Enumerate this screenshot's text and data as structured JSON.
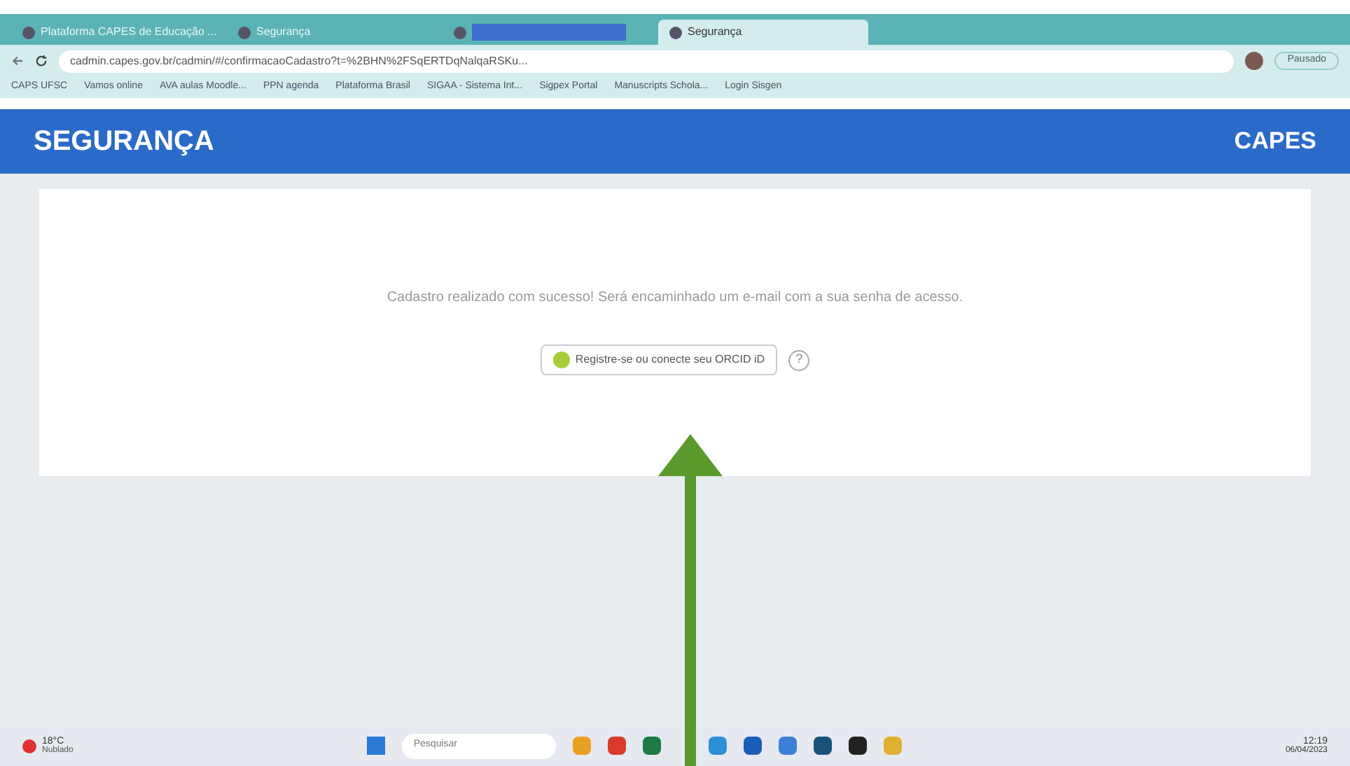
{
  "browser": {
    "tabs": [
      {
        "title": "Plataforma CAPES de Educação ...",
        "selected": false,
        "redacted": false
      },
      {
        "title": "Segurança",
        "selected": false,
        "redacted": false
      },
      {
        "selected": false,
        "redacted": true
      },
      {
        "title": "Segurança",
        "selected": true,
        "redacted": false
      }
    ],
    "address": "cadmin.capes.gov.br/cadmin/#/confirmacaoCadastro?t=%2BHN%2FSqERTDqNalqaRSKu...",
    "profile": "Pausado",
    "bookmarks": [
      "CAPS UFSC",
      "Vamos online",
      "AVA aulas Moodle...",
      "PPN agenda",
      "Plataforma Brasil",
      "SIGAA - Sistema Int...",
      "Sigpex Portal",
      "Manuscripts Schola...",
      "Login Sisgen"
    ]
  },
  "header": {
    "title": "SEGURANÇA",
    "logo": "CAPES"
  },
  "message": "Cadastro realizado com sucesso! Será encaminhado um e-mail com a sua senha de acesso.",
  "orcid_button": {
    "label": "Registre-se ou conecte seu ORCID iD",
    "help": "?"
  },
  "taskbar": {
    "weather_temp": "18°C",
    "weather_text": "Nublado",
    "search_placeholder": "Pesquisar",
    "time": "12:19",
    "date": "06/04/2023"
  }
}
